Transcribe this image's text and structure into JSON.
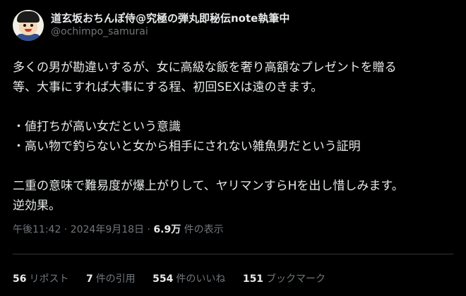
{
  "author": {
    "display_name": "道玄坂おちんぽ侍@究極の弾丸即秘伝note執筆中",
    "handle": "@ochimpo_samurai"
  },
  "tweet": {
    "lines": [
      "多くの男が勘違いするが、女に高級な飯を奢り高額なプレゼントを贈る",
      "等、大事にすれば大事にする程、初回SEXは遠のきます。",
      "",
      "・値打ちが高い女だという意識",
      "・高い物で釣らないと女から相手にされない雑魚男だという証明",
      "",
      "二重の意味で難易度が爆上がりして、ヤリマンすらHを出し惜しみます。",
      "逆効果。"
    ]
  },
  "meta": {
    "timestamp": "午後11:42 · 2024年9月18日 · ",
    "views_count": "6.9万",
    "views_label": " 件の表示"
  },
  "stats": [
    {
      "num": "56",
      "label": "リポスト"
    },
    {
      "num": "7",
      "label": "件の引用"
    },
    {
      "num": "554",
      "label": "件のいいね"
    },
    {
      "num": "151",
      "label": "ブックマーク"
    }
  ],
  "colors": {
    "background": "#000000",
    "text": "#e7e9ea",
    "muted": "#71767b",
    "divider": "#2f3336"
  }
}
